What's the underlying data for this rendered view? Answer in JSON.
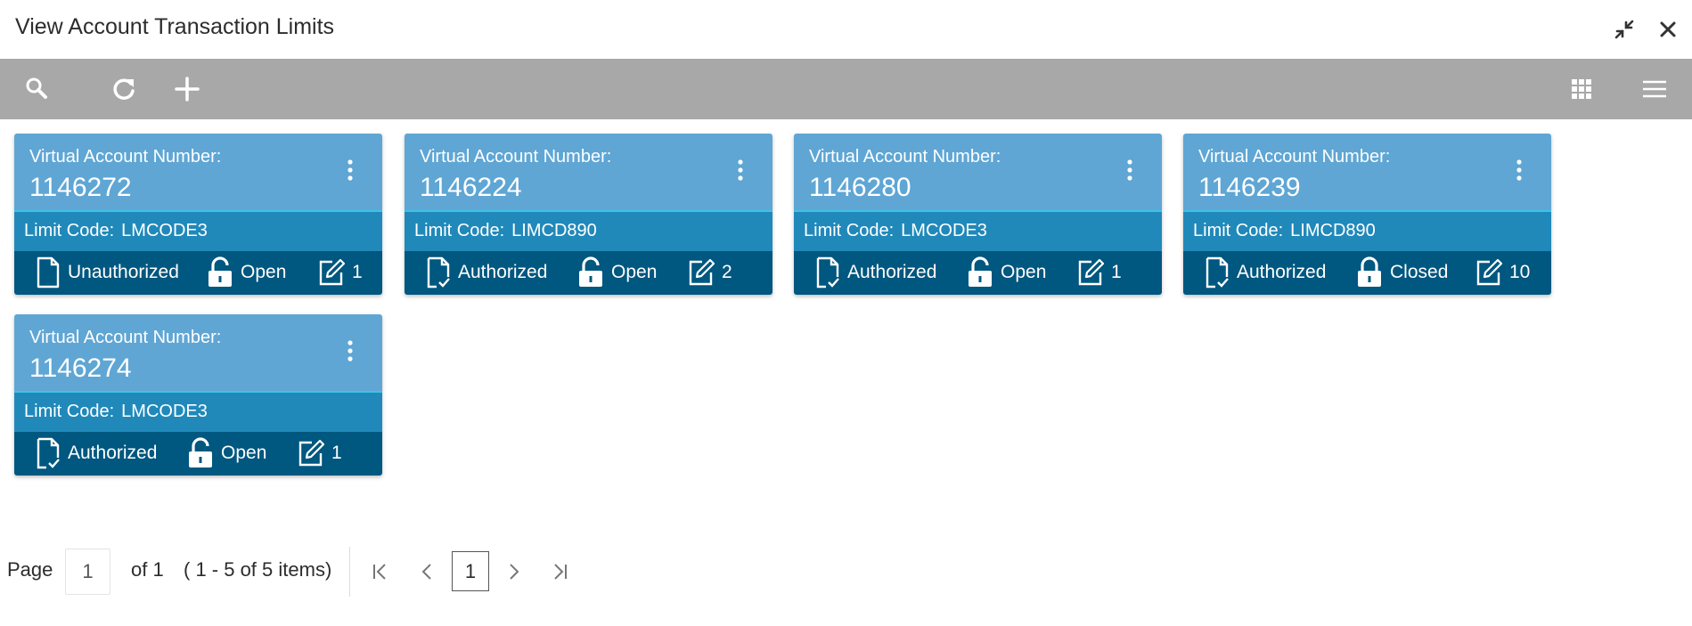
{
  "window": {
    "title": "View Account Transaction Limits",
    "minimize_icon": "collapse-arrows-icon",
    "close_icon": "close-icon"
  },
  "toolbar": {
    "left_icons": [
      "search-icon",
      "refresh-icon",
      "add-icon"
    ],
    "right_icons": [
      "grid-view-icon",
      "list-view-icon"
    ]
  },
  "cards": [
    {
      "van_label": "Virtual Account Number:",
      "van_value": "1146272",
      "limit_label": "Limit Code:",
      "limit_value": "LMCODE3",
      "auth_status": "Unauthorized",
      "record_status": "Open",
      "modification_no": "1"
    },
    {
      "van_label": "Virtual Account Number:",
      "van_value": "1146224",
      "limit_label": "Limit Code:",
      "limit_value": "LIMCD890",
      "auth_status": "Authorized",
      "record_status": "Open",
      "modification_no": "2"
    },
    {
      "van_label": "Virtual Account Number:",
      "van_value": "1146280",
      "limit_label": "Limit Code:",
      "limit_value": "LMCODE3",
      "auth_status": "Authorized",
      "record_status": "Open",
      "modification_no": "1"
    },
    {
      "van_label": "Virtual Account Number:",
      "van_value": "1146239",
      "limit_label": "Limit Code:",
      "limit_value": "LIMCD890",
      "auth_status": "Authorized",
      "record_status": "Closed",
      "modification_no": "10"
    },
    {
      "van_label": "Virtual Account Number:",
      "van_value": "1146274",
      "limit_label": "Limit Code:",
      "limit_value": "LMCODE3",
      "auth_status": "Authorized",
      "record_status": "Open",
      "modification_no": "1"
    }
  ],
  "pagination": {
    "page_label": "Page",
    "page_input_value": "1",
    "of_text": "of 1",
    "items_text": "( 1 - 5 of 5 items)",
    "current_page": "1"
  },
  "colors": {
    "toolbar_bg": "#a8a8a8",
    "card_head": "#5fa6d4",
    "card_limit": "#2089ba",
    "card_foot": "#00577f"
  }
}
